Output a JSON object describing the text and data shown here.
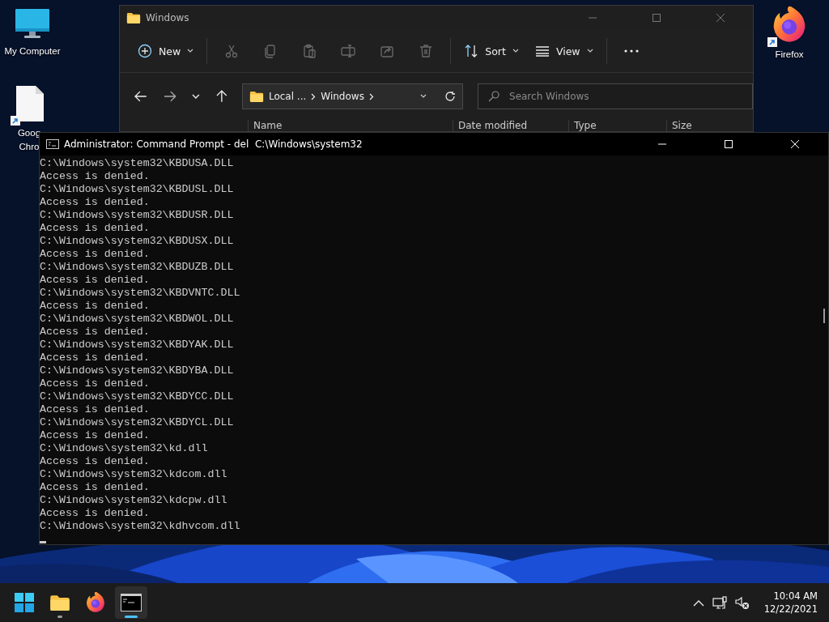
{
  "desktop_icons": [
    {
      "kind": "computer",
      "lines": [
        "My Computer"
      ]
    },
    {
      "kind": "file",
      "lines": [
        "Goog",
        "Chro"
      ],
      "shortcut": true
    },
    {
      "kind": "firefox",
      "lines": [
        "Firefox"
      ],
      "shortcut": true
    }
  ],
  "explorer": {
    "title": "Windows",
    "toolbar": [
      {
        "kind": "new",
        "label": "New"
      },
      {
        "kind": "cut"
      },
      {
        "kind": "copy"
      },
      {
        "kind": "paste"
      },
      {
        "kind": "rename"
      },
      {
        "kind": "share"
      },
      {
        "kind": "delete"
      },
      {
        "kind": "sort",
        "label": "Sort"
      },
      {
        "kind": "view",
        "label": "View"
      },
      {
        "kind": "more"
      }
    ],
    "address": [
      "Local ...",
      "Windows"
    ],
    "search": {
      "placeholder": "Search Windows"
    },
    "columns": [
      "Name",
      "Date modified",
      "Type",
      "Size"
    ]
  },
  "console": {
    "title": "Administrator: Command Prompt - del  C:\\Windows\\system32",
    "lines": [
      "C:\\Windows\\system32\\KBDUSA.DLL",
      "Access is denied.",
      "C:\\Windows\\system32\\KBDUSL.DLL",
      "Access is denied.",
      "C:\\Windows\\system32\\KBDUSR.DLL",
      "Access is denied.",
      "C:\\Windows\\system32\\KBDUSX.DLL",
      "Access is denied.",
      "C:\\Windows\\system32\\KBDUZB.DLL",
      "Access is denied.",
      "C:\\Windows\\system32\\KBDVNTC.DLL",
      "Access is denied.",
      "C:\\Windows\\system32\\KBDWOL.DLL",
      "Access is denied.",
      "C:\\Windows\\system32\\KBDYAK.DLL",
      "Access is denied.",
      "C:\\Windows\\system32\\KBDYBA.DLL",
      "Access is denied.",
      "C:\\Windows\\system32\\KBDYCC.DLL",
      "Access is denied.",
      "C:\\Windows\\system32\\KBDYCL.DLL",
      "Access is denied.",
      "C:\\Windows\\system32\\kd.dll",
      "Access is denied.",
      "C:\\Windows\\system32\\kdcom.dll",
      "Access is denied.",
      "C:\\Windows\\system32\\kdcpw.dll",
      "Access is denied.",
      "C:\\Windows\\system32\\kdhvcom.dll"
    ]
  },
  "taskbar": {
    "apps": [
      {
        "kind": "start",
        "running": false,
        "selected": false
      },
      {
        "kind": "explorer",
        "running": true,
        "selected": false
      },
      {
        "kind": "firefox",
        "running": false,
        "selected": false
      },
      {
        "kind": "terminal",
        "running": true,
        "selected": true
      }
    ],
    "tray": [
      {
        "kind": "chevron"
      },
      {
        "kind": "network"
      },
      {
        "kind": "speaker-muted"
      }
    ],
    "time": "10:04 AM",
    "date": "12/22/2021"
  }
}
